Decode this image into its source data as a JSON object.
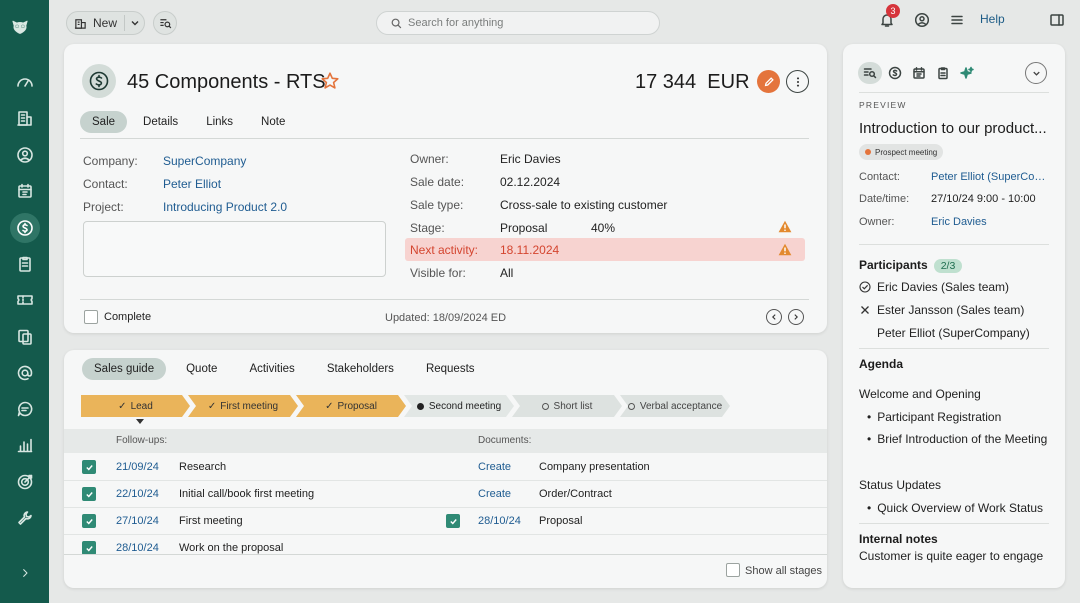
{
  "topbar": {
    "new_label": "New",
    "search_placeholder": "Search for anything",
    "notifications_count": "3",
    "help_label": "Help"
  },
  "rail": {
    "items": [
      "dashboard",
      "companies",
      "contacts",
      "calendar",
      "sales",
      "tasks",
      "tickets",
      "documents",
      "email",
      "messages",
      "reports",
      "goals",
      "tools"
    ],
    "active": "sales"
  },
  "deal": {
    "title": "45 Components - RTS",
    "amount": "17 344",
    "currency": "EUR",
    "tabs": [
      "Sale",
      "Details",
      "Links",
      "Note"
    ],
    "active_tab": "Sale",
    "company_label": "Company:",
    "company": "SuperCompany",
    "contact_label": "Contact:",
    "contact": "Peter Elliot",
    "project_label": "Project:",
    "project": "Introducing Product 2.0",
    "owner_label": "Owner:",
    "owner": "Eric Davies",
    "sale_date_label": "Sale date:",
    "sale_date": "02.12.2024",
    "sale_type_label": "Sale type:",
    "sale_type": "Cross-sale to existing customer",
    "stage_label": "Stage:",
    "stage": "Proposal",
    "stage_percent": "40%",
    "next_activity_label": "Next activity:",
    "next_activity": "18.11.2024",
    "visible_for_label": "Visible for:",
    "visible_for": "All",
    "complete_label": "Complete",
    "updated": "Updated: 18/09/2024 ED"
  },
  "guide": {
    "tabs": [
      "Sales guide",
      "Quote",
      "Activities",
      "Stakeholders",
      "Requests"
    ],
    "active_tab": "Sales guide",
    "stages": [
      {
        "label": "Lead",
        "state": "done"
      },
      {
        "label": "First meeting",
        "state": "done"
      },
      {
        "label": "Proposal",
        "state": "done"
      },
      {
        "label": "Second meeting",
        "state": "current"
      },
      {
        "label": "Short list",
        "state": "todo"
      },
      {
        "label": "Verbal acceptance",
        "state": "todo"
      }
    ],
    "followups_header": "Follow-ups:",
    "documents_header": "Documents:",
    "followups": [
      {
        "date": "21/09/24",
        "text": "Research",
        "done": true
      },
      {
        "date": "22/10/24",
        "text": "Initial call/book first meeting",
        "done": true
      },
      {
        "date": "27/10/24",
        "text": "First meeting",
        "done": true
      },
      {
        "date": "28/10/24",
        "text": "Work on the proposal",
        "done": true
      }
    ],
    "documents": [
      {
        "action": "Create",
        "text": "Company presentation",
        "done": false
      },
      {
        "action": "Create",
        "text": "Order/Contract",
        "done": false
      },
      {
        "action": "28/10/24",
        "text": "Proposal",
        "done": true
      }
    ],
    "show_all_label": "Show all stages"
  },
  "preview": {
    "caption": "PREVIEW",
    "title": "Introduction to our product...",
    "tag": "Prospect meeting",
    "contact_label": "Contact:",
    "contact": "Peter Elliot (SuperCompany)",
    "datetime_label": "Date/time:",
    "datetime": "27/10/24  9:00 - 10:00",
    "owner_label": "Owner:",
    "owner": "Eric Davies",
    "participants_label": "Participants",
    "participants_count": "2/3",
    "participants": [
      {
        "name": "Eric Davies  (Sales team)",
        "status": "accepted"
      },
      {
        "name": "Ester Jansson (Sales team)",
        "status": "declined"
      },
      {
        "name": "Peter Elliot (SuperCompany)",
        "status": "none"
      }
    ],
    "agenda_label": "Agenda",
    "agenda_1_title": "Welcome and Opening",
    "agenda_1_items": [
      "Participant Registration",
      "Brief Introduction of the Meeting"
    ],
    "agenda_2_title": "Status Updates",
    "agenda_2_items": [
      "Quick Overview of Work Status"
    ],
    "notes_label": "Internal notes",
    "notes": "Customer is quite eager to engage"
  },
  "colors": {
    "rail": "#145a4c",
    "accent_orange": "#e4743c",
    "stage_done": "#eab45a",
    "alert_bg": "#f7d3d0",
    "alert_text": "#d4452f",
    "link": "#1f5c91",
    "check": "#2f8a75"
  }
}
